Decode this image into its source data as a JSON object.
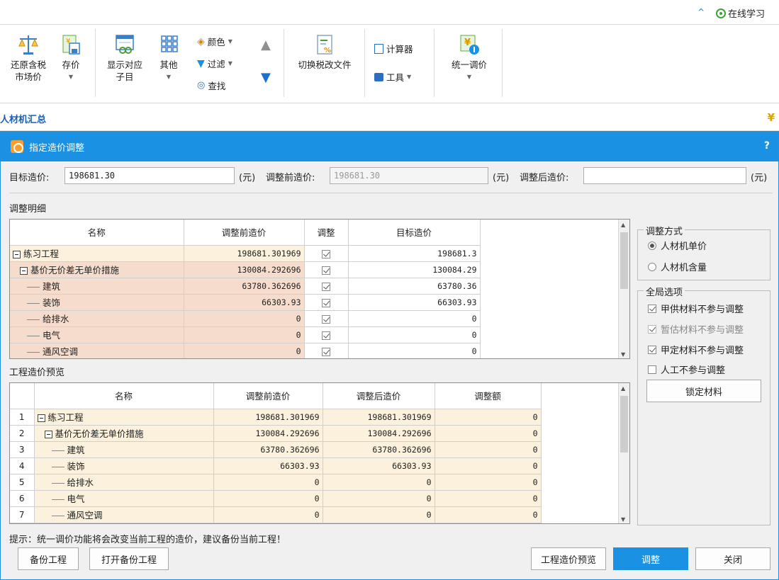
{
  "topbar": {
    "learn_label": "在线学习"
  },
  "ribbon": {
    "restore_tax_label_1": "还原含税",
    "restore_tax_label_2": "市场价",
    "store_price_label": "存价",
    "show_sub_label_1": "显示对应",
    "show_sub_label_2": "子目",
    "other_label": "其他",
    "color_label": "颜色",
    "filter_label": "过滤",
    "find_label": "查找",
    "switch_tax_label": "切换税改文件",
    "calculator_label": "计算器",
    "tools_label": "工具",
    "unify_price_label": "统一调价"
  },
  "tabs": {
    "active": "人材机汇总"
  },
  "dialog": {
    "title": "指定造价调整",
    "help": "?",
    "target_label": "目标造价:",
    "target_value": "198681.30",
    "unit1": "(元)",
    "before_label": "调整前造价:",
    "before_value": "198681.30",
    "unit2": "(元)",
    "after_label": "调整后造价:",
    "after_value": "",
    "unit3": "(元)",
    "detail_section": "调整明细",
    "preview_section": "工程造价预览",
    "detail_headers": [
      "名称",
      "调整前造价",
      "调整",
      "目标造价"
    ],
    "detail_rows": [
      {
        "name": "练习工程",
        "before": "198681.301969",
        "target": "198681.3"
      },
      {
        "name": "基价无价差无单价措施",
        "before": "130084.292696",
        "target": "130084.29"
      },
      {
        "name": "建筑",
        "before": "63780.362696",
        "target": "63780.36"
      },
      {
        "name": "装饰",
        "before": "66303.93",
        "target": "66303.93"
      },
      {
        "name": "给排水",
        "before": "0",
        "target": "0"
      },
      {
        "name": "电气",
        "before": "0",
        "target": "0"
      },
      {
        "name": "通风空调",
        "before": "0",
        "target": "0"
      }
    ],
    "preview_headers": [
      "名称",
      "调整前造价",
      "调整后造价",
      "调整额"
    ],
    "preview_rows": [
      {
        "idx": "1",
        "name": "练习工程",
        "before": "198681.301969",
        "after": "198681.301969",
        "delta": "0"
      },
      {
        "idx": "2",
        "name": "基价无价差无单价措施",
        "before": "130084.292696",
        "after": "130084.292696",
        "delta": "0"
      },
      {
        "idx": "3",
        "name": "建筑",
        "before": "63780.362696",
        "after": "63780.362696",
        "delta": "0"
      },
      {
        "idx": "4",
        "name": "装饰",
        "before": "66303.93",
        "after": "66303.93",
        "delta": "0"
      },
      {
        "idx": "5",
        "name": "给排水",
        "before": "0",
        "after": "0",
        "delta": "0"
      },
      {
        "idx": "6",
        "name": "电气",
        "before": "0",
        "after": "0",
        "delta": "0"
      },
      {
        "idx": "7",
        "name": "通风空调",
        "before": "0",
        "after": "0",
        "delta": "0"
      }
    ],
    "method_group": "调整方式",
    "method_opt1": "人材机单价",
    "method_opt2": "人材机含量",
    "global_group": "全局选项",
    "global_opt1": "甲供材料不参与调整",
    "global_opt2": "暂估材料不参与调整",
    "global_opt3": "甲定材料不参与调整",
    "global_opt4": "人工不参与调整",
    "lock_button": "锁定材料",
    "hint": "提示：统一调价功能将会改变当前工程的造价，建议备份当前工程！",
    "backup_button": "备份工程",
    "open_backup_button": "打开备份工程",
    "preview_button": "工程造价预览",
    "adjust_button": "调整",
    "close_button": "关闭"
  },
  "colors": {
    "accent": "#1a91e3",
    "row_fill": "#fbf1dc",
    "row_fill_alt": "#f6dccd"
  }
}
